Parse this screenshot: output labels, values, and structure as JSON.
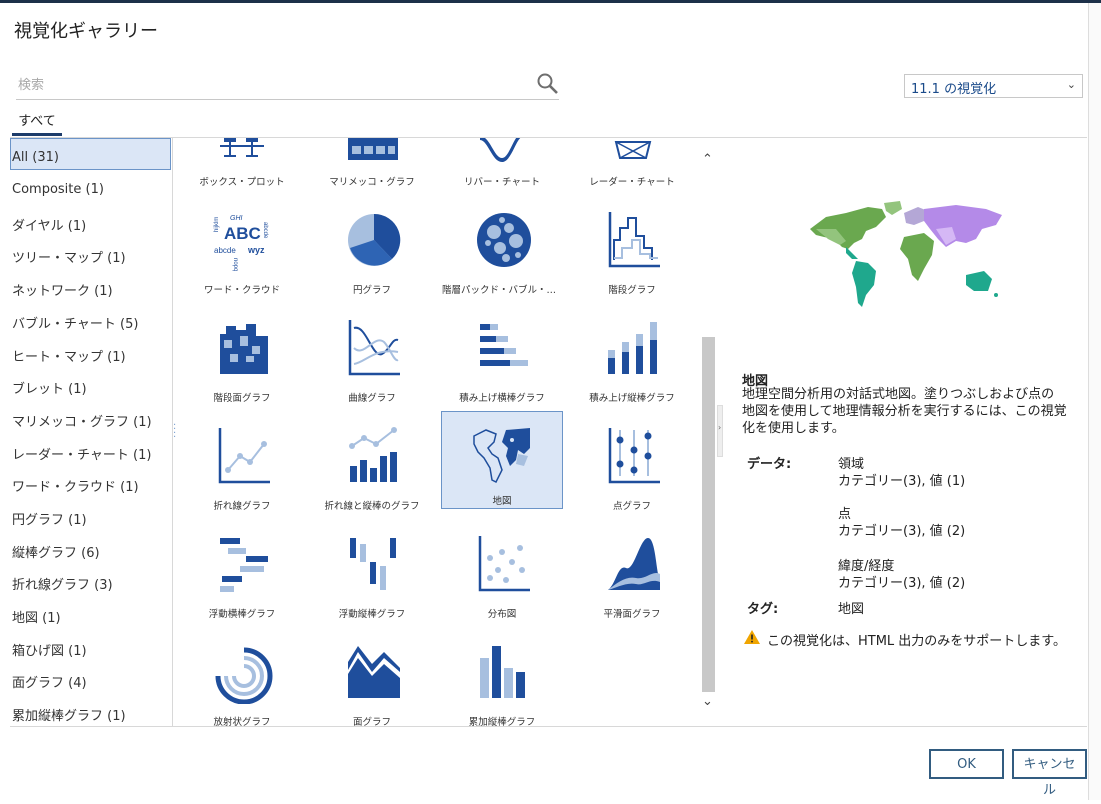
{
  "dialog": {
    "title": "視覚化ギャラリー"
  },
  "search": {
    "placeholder": "検索"
  },
  "version_select": {
    "value": "11.1 の視覚化"
  },
  "tabs": {
    "all": "すべて"
  },
  "categories": [
    "All (31)",
    "Composite (1)",
    "ダイヤル (1)",
    "ツリー・マップ (1)",
    "ネットワーク (1)",
    "バブル・チャート (5)",
    "ヒート・マップ (1)",
    "ブレット (1)",
    "マリメッコ・グラフ (1)",
    "レーダー・チャート (1)",
    "ワード・クラウド (1)",
    "円グラフ (1)",
    "縦棒グラフ (6)",
    "折れ線グラフ (3)",
    "地図 (1)",
    "箱ひげ図 (1)",
    "面グラフ (4)",
    "累加縦棒グラフ (1)"
  ],
  "gallery": [
    {
      "label": "ボックス・プロット",
      "icon": "box-plot-icon"
    },
    {
      "label": "マリメッコ・グラフ",
      "icon": "marimekko-icon"
    },
    {
      "label": "リバー・チャート",
      "icon": "river-chart-icon"
    },
    {
      "label": "レーダー・チャート",
      "icon": "radar-chart-icon"
    },
    {
      "label": "ワード・クラウド",
      "icon": "word-cloud-icon"
    },
    {
      "label": "円グラフ",
      "icon": "pie-chart-icon"
    },
    {
      "label": "階層パックド・バブル・チ…",
      "icon": "packed-bubble-icon"
    },
    {
      "label": "階段グラフ",
      "icon": "step-chart-icon"
    },
    {
      "label": "階段面グラフ",
      "icon": "step-area-icon"
    },
    {
      "label": "曲線グラフ",
      "icon": "curve-chart-icon"
    },
    {
      "label": "積み上げ横棒グラフ",
      "icon": "stacked-bar-icon"
    },
    {
      "label": "積み上げ縦棒グラフ",
      "icon": "stacked-column-icon"
    },
    {
      "label": "折れ線グラフ",
      "icon": "line-chart-icon"
    },
    {
      "label": "折れ線と縦棒のグラフ",
      "icon": "line-column-icon"
    },
    {
      "label": "地図",
      "icon": "map-icon"
    },
    {
      "label": "点グラフ",
      "icon": "point-chart-icon"
    },
    {
      "label": "浮動横棒グラフ",
      "icon": "floating-bar-icon"
    },
    {
      "label": "浮動縦棒グラフ",
      "icon": "floating-column-icon"
    },
    {
      "label": "分布図",
      "icon": "scatter-icon"
    },
    {
      "label": "平滑面グラフ",
      "icon": "smooth-area-icon"
    },
    {
      "label": "放射状グラフ",
      "icon": "radial-chart-icon"
    },
    {
      "label": "面グラフ",
      "icon": "area-chart-icon"
    },
    {
      "label": "累加縦棒グラフ",
      "icon": "cumulative-column-icon"
    }
  ],
  "wordcloud_words": {
    "w1": "GHI",
    "w2": "ABC",
    "w3": "abcde",
    "w4": "wyz",
    "w5": "hijklm",
    "w6": "nopq",
    "w7": "abcde"
  },
  "detail": {
    "title": "地図",
    "description": "地理空間分析用の対話式地図。塗りつぶしおよび点の地図を使用して地理情報分析を実行するには、この視覚化を使用します。",
    "data_key": "データ:",
    "data_groups": [
      {
        "name": "領域",
        "value": "カテゴリー(3), 値 (1)"
      },
      {
        "name": "点",
        "value": "カテゴリー(3), 値 (2)"
      },
      {
        "name": "緯度/経度",
        "value": "カテゴリー(3), 値 (2)"
      }
    ],
    "tag_key": "タグ:",
    "tag_value": "地図",
    "warning": "この視覚化は、HTML 出力のみをサポートします。"
  },
  "buttons": {
    "ok": "OK",
    "cancel": "キャンセル"
  },
  "colors": {
    "accent": "#325c80",
    "icon_blue": "#1f4e9c",
    "icon_light": "#a7bfdf",
    "selection": "#dbe6f6"
  }
}
